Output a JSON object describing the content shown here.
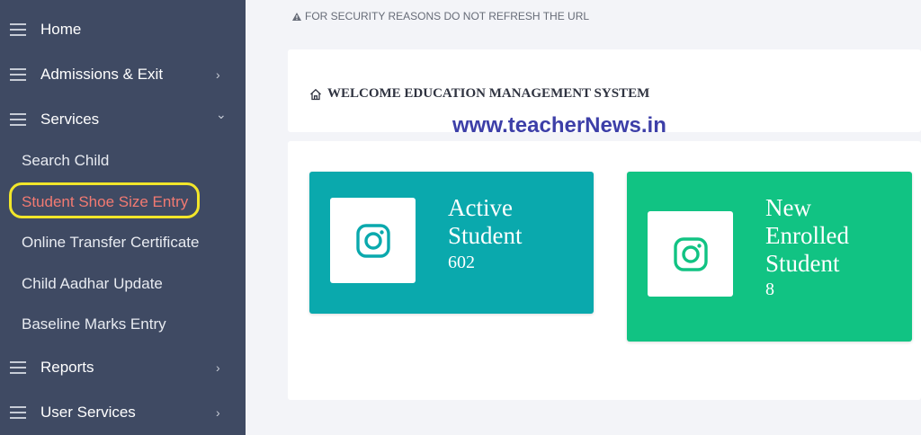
{
  "sidebar": {
    "items": [
      {
        "label": "Home"
      },
      {
        "label": "Admissions & Exit",
        "chevron": "›"
      },
      {
        "label": "Services",
        "chevron": "⌄"
      },
      {
        "label": "Reports",
        "chevron": "›"
      },
      {
        "label": "User Services",
        "chevron": "›"
      }
    ],
    "sub_items": [
      {
        "label": "Search Child"
      },
      {
        "label": "Student Shoe Size Entry"
      },
      {
        "label": "Online Transfer Certificate"
      },
      {
        "label": "Child Aadhar Update"
      },
      {
        "label": "Baseline Marks Entry"
      }
    ]
  },
  "security_note": "FOR SECURITY REASONS DO NOT REFRESH THE URL",
  "welcome_title": "WELCOME EDUCATION MANAGEMENT SYSTEM",
  "watermark": "www.teacherNews.in",
  "stats": [
    {
      "label_lines": [
        "Active",
        "Student"
      ],
      "value": "602",
      "color": "#0aa9ad",
      "icon": "instagram-icon"
    },
    {
      "label_lines": [
        "New",
        "Enrolled",
        "Student"
      ],
      "value": "8",
      "color": "#11c383",
      "icon": "instagram-icon"
    }
  ],
  "colors": {
    "sidebar": "#3f4a63",
    "active_sub": "#f27a72",
    "highlight": "#f2e62a"
  }
}
